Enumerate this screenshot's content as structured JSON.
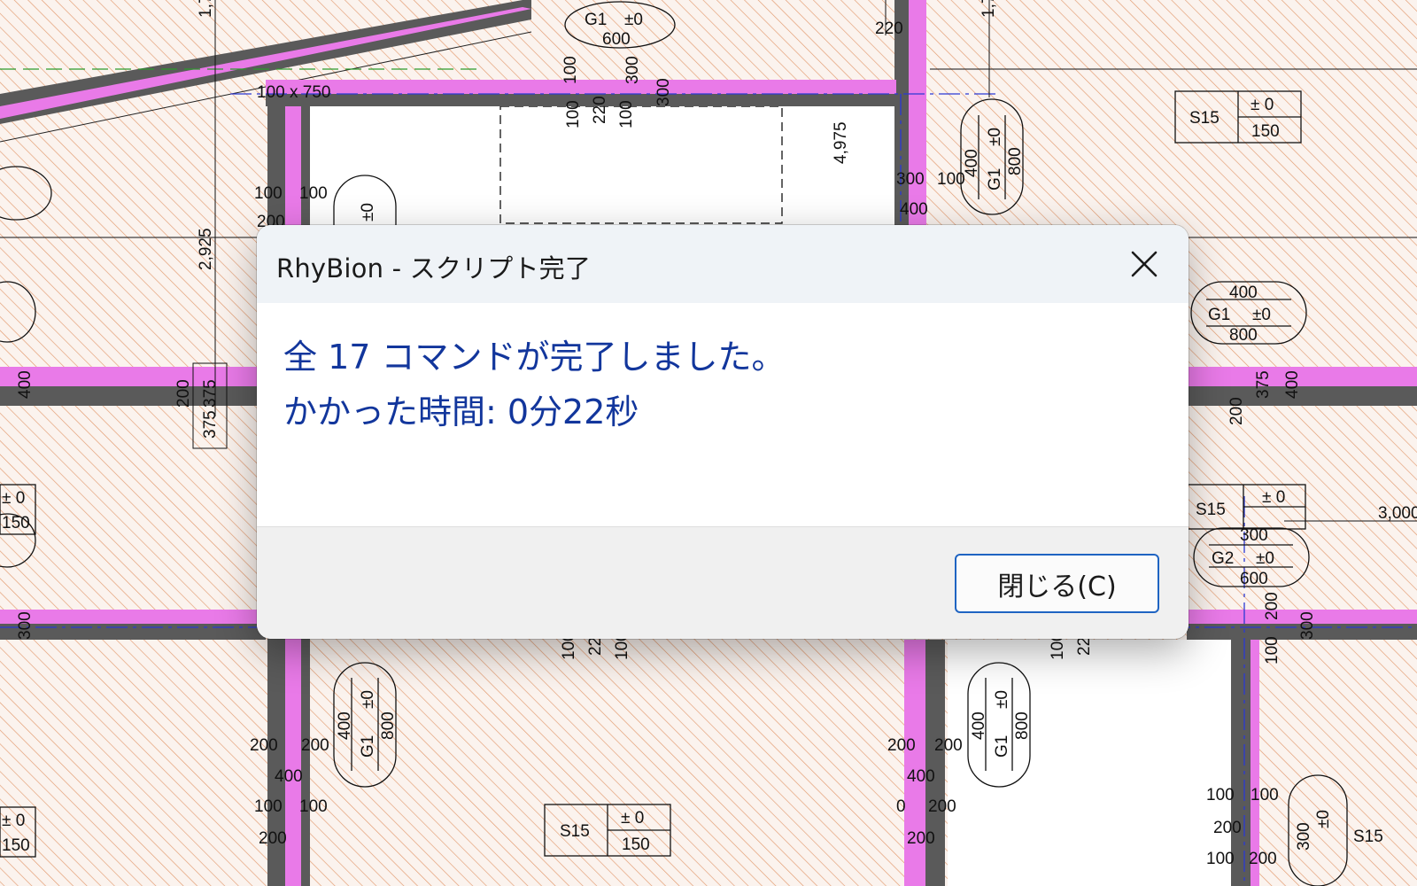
{
  "dialog": {
    "title": "RhyBion - スクリプト完了",
    "message_line1": "全 17 コマンドが完了しました。",
    "message_line2": "かかった時間: 0分22秒",
    "close_button_label": "閉じる(C)",
    "close_icon": "close-icon"
  },
  "background_drawing": {
    "slab_tags": [
      {
        "id": "S15",
        "level": "± 0",
        "thickness": "150"
      },
      {
        "id": "S15",
        "level": "± 0",
        "thickness": "150"
      },
      {
        "id": "S15",
        "level": "± 0",
        "thickness": "150"
      }
    ],
    "beam_tags": [
      {
        "id": "G1",
        "level": "±0",
        "w": "400",
        "h": "800"
      },
      {
        "id": "G1",
        "level": "±0",
        "w": "400",
        "h": "800"
      },
      {
        "id": "G1",
        "level": "±0",
        "w": "400",
        "h": "800"
      },
      {
        "id": "G1",
        "level": "±0",
        "w": "400",
        "h": "800"
      },
      {
        "id": "G2",
        "level": "±0",
        "w": "300",
        "h": "600"
      }
    ],
    "dimensions": [
      "4,975",
      "2,925",
      "3,000",
      "100",
      "200",
      "300",
      "400",
      "220",
      "375"
    ]
  },
  "colors": {
    "wall_pink": "#e97ae8",
    "wall_gray": "#5a5a5a",
    "hatch": "#e39a6e",
    "grid_blue": "#2b39d4",
    "message_text": "#12369c",
    "button_border": "#1f64c2"
  }
}
